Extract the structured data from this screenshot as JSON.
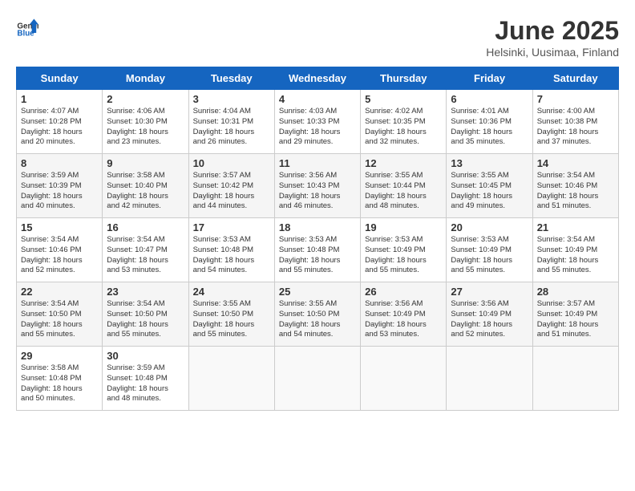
{
  "logo": {
    "general": "General",
    "blue": "Blue"
  },
  "title": "June 2025",
  "subtitle": "Helsinki, Uusimaa, Finland",
  "days_of_week": [
    "Sunday",
    "Monday",
    "Tuesday",
    "Wednesday",
    "Thursday",
    "Friday",
    "Saturday"
  ],
  "weeks": [
    [
      {
        "day": "1",
        "info": "Sunrise: 4:07 AM\nSunset: 10:28 PM\nDaylight: 18 hours\nand 20 minutes."
      },
      {
        "day": "2",
        "info": "Sunrise: 4:06 AM\nSunset: 10:30 PM\nDaylight: 18 hours\nand 23 minutes."
      },
      {
        "day": "3",
        "info": "Sunrise: 4:04 AM\nSunset: 10:31 PM\nDaylight: 18 hours\nand 26 minutes."
      },
      {
        "day": "4",
        "info": "Sunrise: 4:03 AM\nSunset: 10:33 PM\nDaylight: 18 hours\nand 29 minutes."
      },
      {
        "day": "5",
        "info": "Sunrise: 4:02 AM\nSunset: 10:35 PM\nDaylight: 18 hours\nand 32 minutes."
      },
      {
        "day": "6",
        "info": "Sunrise: 4:01 AM\nSunset: 10:36 PM\nDaylight: 18 hours\nand 35 minutes."
      },
      {
        "day": "7",
        "info": "Sunrise: 4:00 AM\nSunset: 10:38 PM\nDaylight: 18 hours\nand 37 minutes."
      }
    ],
    [
      {
        "day": "8",
        "info": "Sunrise: 3:59 AM\nSunset: 10:39 PM\nDaylight: 18 hours\nand 40 minutes."
      },
      {
        "day": "9",
        "info": "Sunrise: 3:58 AM\nSunset: 10:40 PM\nDaylight: 18 hours\nand 42 minutes."
      },
      {
        "day": "10",
        "info": "Sunrise: 3:57 AM\nSunset: 10:42 PM\nDaylight: 18 hours\nand 44 minutes."
      },
      {
        "day": "11",
        "info": "Sunrise: 3:56 AM\nSunset: 10:43 PM\nDaylight: 18 hours\nand 46 minutes."
      },
      {
        "day": "12",
        "info": "Sunrise: 3:55 AM\nSunset: 10:44 PM\nDaylight: 18 hours\nand 48 minutes."
      },
      {
        "day": "13",
        "info": "Sunrise: 3:55 AM\nSunset: 10:45 PM\nDaylight: 18 hours\nand 49 minutes."
      },
      {
        "day": "14",
        "info": "Sunrise: 3:54 AM\nSunset: 10:46 PM\nDaylight: 18 hours\nand 51 minutes."
      }
    ],
    [
      {
        "day": "15",
        "info": "Sunrise: 3:54 AM\nSunset: 10:46 PM\nDaylight: 18 hours\nand 52 minutes."
      },
      {
        "day": "16",
        "info": "Sunrise: 3:54 AM\nSunset: 10:47 PM\nDaylight: 18 hours\nand 53 minutes."
      },
      {
        "day": "17",
        "info": "Sunrise: 3:53 AM\nSunset: 10:48 PM\nDaylight: 18 hours\nand 54 minutes."
      },
      {
        "day": "18",
        "info": "Sunrise: 3:53 AM\nSunset: 10:48 PM\nDaylight: 18 hours\nand 55 minutes."
      },
      {
        "day": "19",
        "info": "Sunrise: 3:53 AM\nSunset: 10:49 PM\nDaylight: 18 hours\nand 55 minutes."
      },
      {
        "day": "20",
        "info": "Sunrise: 3:53 AM\nSunset: 10:49 PM\nDaylight: 18 hours\nand 55 minutes."
      },
      {
        "day": "21",
        "info": "Sunrise: 3:54 AM\nSunset: 10:49 PM\nDaylight: 18 hours\nand 55 minutes."
      }
    ],
    [
      {
        "day": "22",
        "info": "Sunrise: 3:54 AM\nSunset: 10:50 PM\nDaylight: 18 hours\nand 55 minutes."
      },
      {
        "day": "23",
        "info": "Sunrise: 3:54 AM\nSunset: 10:50 PM\nDaylight: 18 hours\nand 55 minutes."
      },
      {
        "day": "24",
        "info": "Sunrise: 3:55 AM\nSunset: 10:50 PM\nDaylight: 18 hours\nand 55 minutes."
      },
      {
        "day": "25",
        "info": "Sunrise: 3:55 AM\nSunset: 10:50 PM\nDaylight: 18 hours\nand 54 minutes."
      },
      {
        "day": "26",
        "info": "Sunrise: 3:56 AM\nSunset: 10:49 PM\nDaylight: 18 hours\nand 53 minutes."
      },
      {
        "day": "27",
        "info": "Sunrise: 3:56 AM\nSunset: 10:49 PM\nDaylight: 18 hours\nand 52 minutes."
      },
      {
        "day": "28",
        "info": "Sunrise: 3:57 AM\nSunset: 10:49 PM\nDaylight: 18 hours\nand 51 minutes."
      }
    ],
    [
      {
        "day": "29",
        "info": "Sunrise: 3:58 AM\nSunset: 10:48 PM\nDaylight: 18 hours\nand 50 minutes."
      },
      {
        "day": "30",
        "info": "Sunrise: 3:59 AM\nSunset: 10:48 PM\nDaylight: 18 hours\nand 48 minutes."
      },
      {
        "day": "",
        "info": ""
      },
      {
        "day": "",
        "info": ""
      },
      {
        "day": "",
        "info": ""
      },
      {
        "day": "",
        "info": ""
      },
      {
        "day": "",
        "info": ""
      }
    ]
  ]
}
